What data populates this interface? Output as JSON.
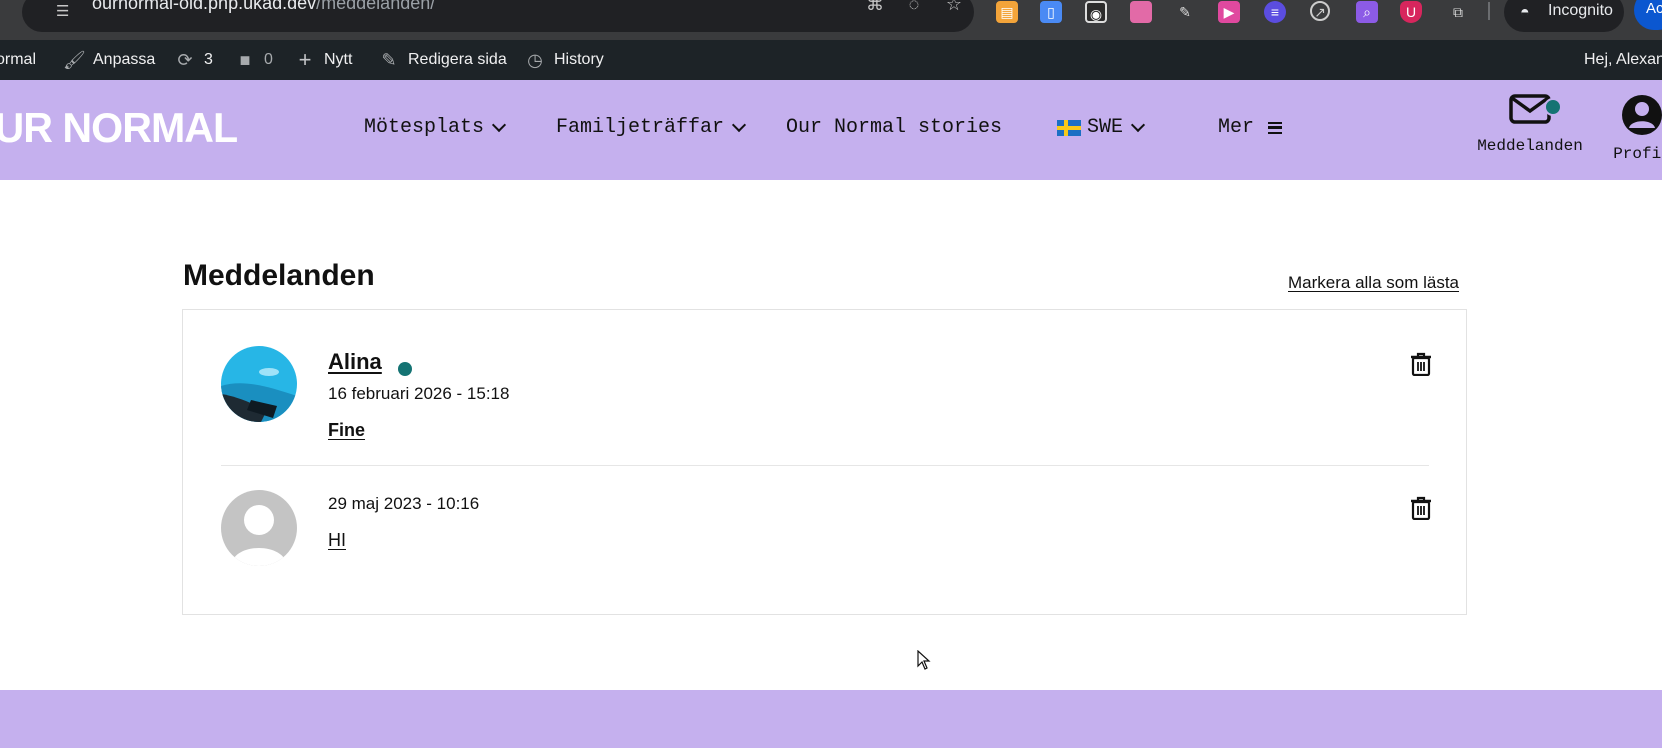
{
  "browser": {
    "url_host": "ournormal-old.php.ukad.dev",
    "url_path": "/meddelanden/",
    "incognito_label": "Incognito",
    "account_initials": "Ac"
  },
  "adminbar": {
    "site_name": "ormal",
    "customize": "Anpassa",
    "updates_count": "3",
    "comments_count": "0",
    "new": "Nytt",
    "edit_page": "Redigera sida",
    "history": "History",
    "greeting": "Hej, Alexan"
  },
  "header": {
    "logo": "UR NORMAL",
    "nav": [
      {
        "label": "Mötesplats"
      },
      {
        "label": "Familjeträffar"
      },
      {
        "label": "Our Normal stories"
      },
      {
        "label": "SWE"
      },
      {
        "label": "Mer"
      }
    ],
    "messages_label": "Meddelanden",
    "profile_label": "Profil"
  },
  "main": {
    "title": "Meddelanden",
    "mark_all_read": "Markera alla som lästa",
    "messages": [
      {
        "sender": "Alina",
        "date": "16 februari 2026 - 15:18",
        "subject": "Fine",
        "online": true
      },
      {
        "sender": "",
        "date": "29 maj 2023 - 10:16",
        "subject": "HI",
        "online": false
      }
    ]
  },
  "colors": {
    "header_bg": "#c5b0ee",
    "online": "#147373",
    "adminbar_bg": "#1d2327"
  }
}
